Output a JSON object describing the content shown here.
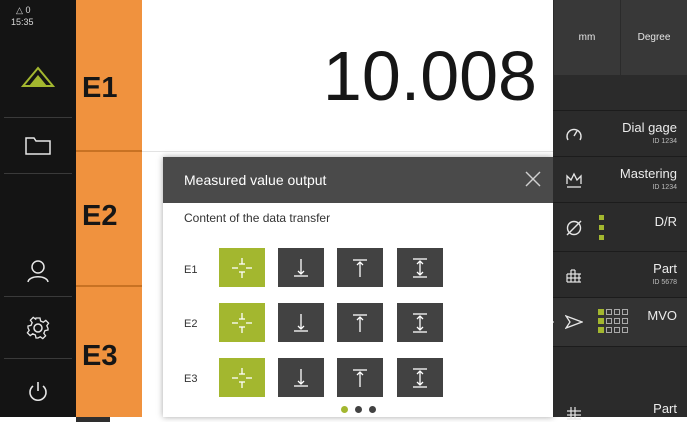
{
  "status": {
    "icon": "delta-triangle-icon",
    "count": "0",
    "time": "15:35"
  },
  "sidebar": {
    "items": [
      {
        "name": "measure-icon"
      },
      {
        "name": "folder-icon"
      },
      {
        "name": "user-icon"
      },
      {
        "name": "settings-icon"
      },
      {
        "name": "power-icon"
      }
    ],
    "collapse": "‹"
  },
  "axes": {
    "e1": "E1",
    "e2": "E2",
    "e3": "E3"
  },
  "main": {
    "value": "10.008"
  },
  "units": {
    "length": "mm",
    "angle": "Degree"
  },
  "dialog": {
    "title": "Measured value output",
    "subtitle": "Content of the data transfer",
    "rows": [
      {
        "label": "E1",
        "selected": 0
      },
      {
        "label": "E2",
        "selected": 0
      },
      {
        "label": "E3",
        "selected": 0
      }
    ],
    "options": [
      "actual-value-icon",
      "min-value-icon",
      "max-value-icon",
      "range-value-icon"
    ],
    "page": {
      "current": 1,
      "total": 3
    }
  },
  "panel": {
    "items": [
      {
        "title": "Dial gage",
        "id": "ID 1234",
        "icon": "dial-gauge-icon"
      },
      {
        "title": "Mastering",
        "id": "ID 1234",
        "icon": "crown-icon"
      },
      {
        "title": "D/R",
        "id": "",
        "icon": "diameter-icon"
      },
      {
        "title": "Part",
        "id": "ID 5678",
        "icon": "part-grid-icon"
      },
      {
        "title": "MVO",
        "id": "",
        "icon": "send-icon"
      },
      {
        "title": "Part",
        "id": "",
        "icon": "part-grid-icon"
      }
    ]
  },
  "colors": {
    "accent_orange": "#f0923e",
    "accent_green": "#a3b72f",
    "sidebar": "#141414",
    "panel": "#2b2b2b"
  }
}
